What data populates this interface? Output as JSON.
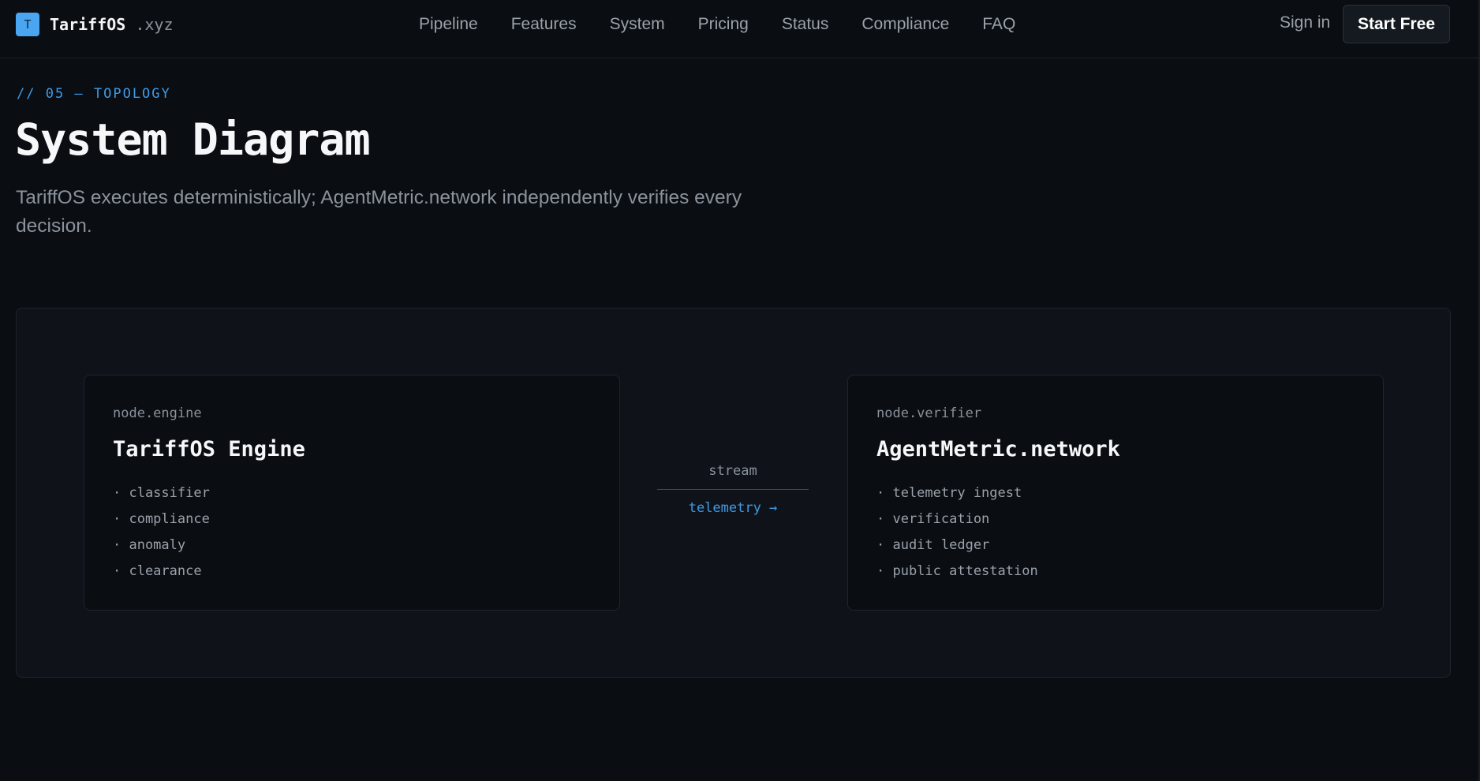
{
  "brand": {
    "logo_letter": "T",
    "name": "TariffOS",
    "tld": ".xyz"
  },
  "nav": {
    "links": [
      "Pipeline",
      "Features",
      "System",
      "Pricing",
      "Status",
      "Compliance",
      "FAQ"
    ],
    "signin": "Sign in",
    "cta": "Start Free"
  },
  "section": {
    "eyebrow": "// 05 — TOPOLOGY",
    "title": "System Diagram",
    "subtitle": "TariffOS executes deterministically; AgentMetric.network independently verifies every decision."
  },
  "diagram": {
    "engine": {
      "id": "node.engine",
      "title": "TariffOS Engine",
      "items": [
        "· classifier",
        "· compliance",
        "· anomaly",
        "· clearance"
      ]
    },
    "connector": {
      "top": "stream",
      "bottom": "telemetry →"
    },
    "verifier": {
      "id": "node.verifier",
      "title": "AgentMetric.network",
      "items": [
        "· telemetry ingest",
        "· verification",
        "· audit ledger",
        "· public attestation"
      ]
    }
  },
  "colors": {
    "background": "#0a0d11",
    "panel": "#0f1319",
    "accent": "#3f9be6",
    "logo": "#4aa6f0"
  }
}
